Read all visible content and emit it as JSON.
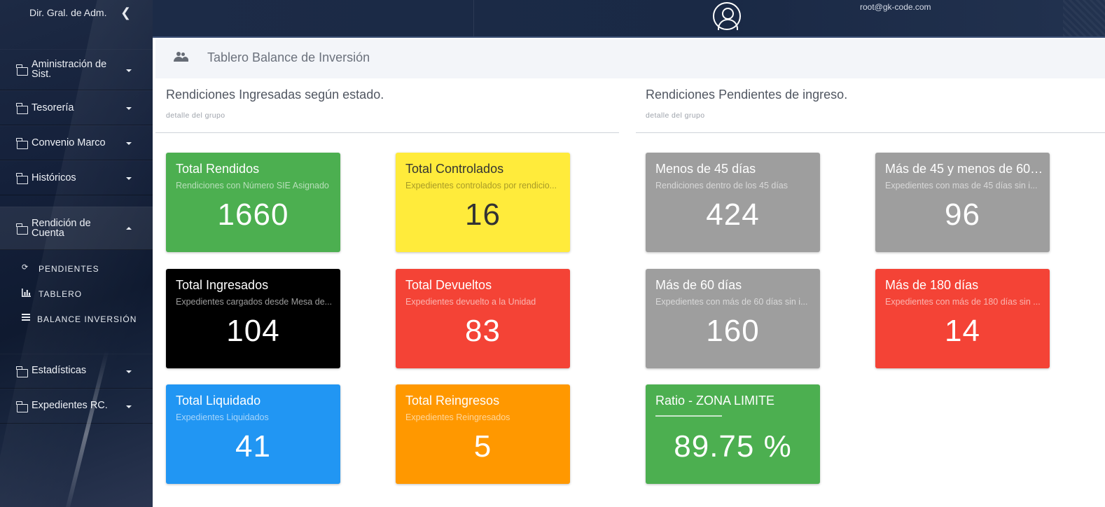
{
  "sidebar": {
    "brand": "Dir. Gral. de Adm.",
    "items": [
      {
        "label_line1": "Aministración de",
        "label_line2": "Sist."
      },
      {
        "label_line1": "Tesorería",
        "label_line2": ""
      },
      {
        "label_line1": "Convenio Marco",
        "label_line2": ""
      },
      {
        "label_line1": "Históricos",
        "label_line2": ""
      },
      {
        "label_line1": "Rendición de",
        "label_line2": "Cuenta"
      },
      {
        "label_line1": "Estadísticas",
        "label_line2": ""
      },
      {
        "label_line1": "Expedientes RC.",
        "label_line2": ""
      }
    ],
    "subitems": [
      {
        "label": "PENDIENTES",
        "icon": "history-icon"
      },
      {
        "label": "TABLERO",
        "icon": "bar-chart-icon"
      },
      {
        "label": "BALANCE INVERSIÓN",
        "icon": "list-icon"
      }
    ]
  },
  "topbar": {
    "user_email": "root@gk-code.com"
  },
  "header": {
    "title": "Tablero Balance de Inversión"
  },
  "sections": {
    "left": {
      "title": "Rendiciones Ingresadas según estado.",
      "subtitle": "detalle del grupo"
    },
    "right": {
      "title": "Rendiciones Pendientes de ingreso.",
      "subtitle": "detalle del grupo"
    }
  },
  "cards": [
    {
      "title": "Total Rendidos",
      "subtitle": "Rendiciones con Número SIE Asignado",
      "value": "1660",
      "color": "#4caf50"
    },
    {
      "title": "Total Controlados",
      "subtitle": "Expedientes controlados por rendicio...",
      "value": "16",
      "color": "#ffeb3b"
    },
    {
      "title": "Menos de 45 días",
      "subtitle": "Rendiciones dentro de los 45 días",
      "value": "424",
      "color": "#9e9e9e"
    },
    {
      "title": "Más de 45 y menos de 60 ...",
      "subtitle": "Expedientes con mas de 45 días sin i...",
      "value": "96",
      "color": "#9e9e9e"
    },
    {
      "title": "Total Ingresados",
      "subtitle": "Expedientes cargados desde Mesa de...",
      "value": "104",
      "color": "#000000"
    },
    {
      "title": "Total Devueltos",
      "subtitle": "Expedientes devuelto a la Unidad",
      "value": "83",
      "color": "#f44336"
    },
    {
      "title": "Más de 60 días",
      "subtitle": "Expedientes con más de 60 días sin i...",
      "value": "160",
      "color": "#9e9e9e"
    },
    {
      "title": "Más de 180 días",
      "subtitle": "Expedientes con más de 180 días sin ...",
      "value": "14",
      "color": "#f44336"
    },
    {
      "title": "Total Liquidado",
      "subtitle": "Expedientes Liquidados",
      "value": "41",
      "color": "#2196f3"
    },
    {
      "title": "Total Reingresos",
      "subtitle": "Expedientes Reingresados",
      "value": "5",
      "color": "#ff9800"
    },
    {
      "title": "Ratio - ZONA LIMITE",
      "subtitle": "",
      "value": "89.75 %",
      "color": "#4caf50"
    }
  ]
}
